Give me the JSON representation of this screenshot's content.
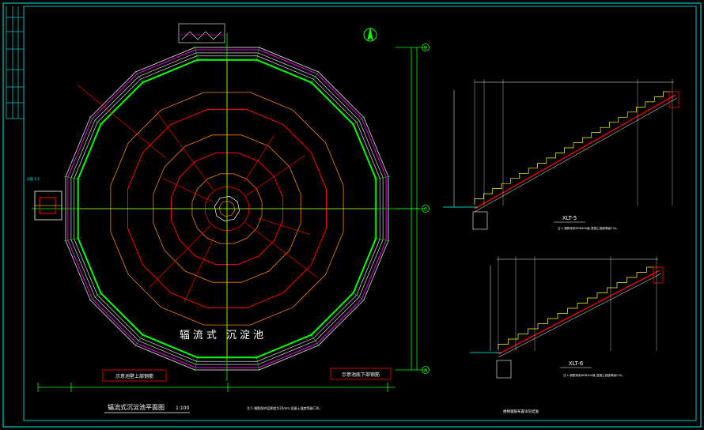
{
  "drawing": {
    "main_title": "辐流式沉淀池平面图",
    "main_scale": "1:100",
    "tank_label": "辐流式 沉淀池",
    "section_a_label": "XLT-5",
    "section_b_label": "XLT-6",
    "legend_left": "示意池壁上部钢筋",
    "legend_right": "示意池底下部钢筋",
    "bottom_note": "注:1.钢筋保护层厚度为35mm,混凝土强度等级C30。",
    "right_bottom_note": "楼梯钢筋布置详见结施",
    "note_a": "注:1.钢筋采用HRB400级,混凝土强度等级C30。",
    "note_b": "注:1.钢筋采用HRB400级,混凝土强度等级C30。",
    "axis_top": "B",
    "axis_mid": "C",
    "axis_bottom": "A",
    "north_mark": "N"
  },
  "colors": {
    "background": "#000000",
    "frame": "#00c8c8",
    "ring_outer": "#ffffff",
    "ring_magenta": "#ff00ff",
    "ring_green": "#00ff00",
    "ring_orange": "#ff8000",
    "ring_red": "#ff0000",
    "center_lines": "#ffff00",
    "dim": "#00ff00",
    "text": "#ffffff",
    "cyan_text": "#00ffff"
  }
}
